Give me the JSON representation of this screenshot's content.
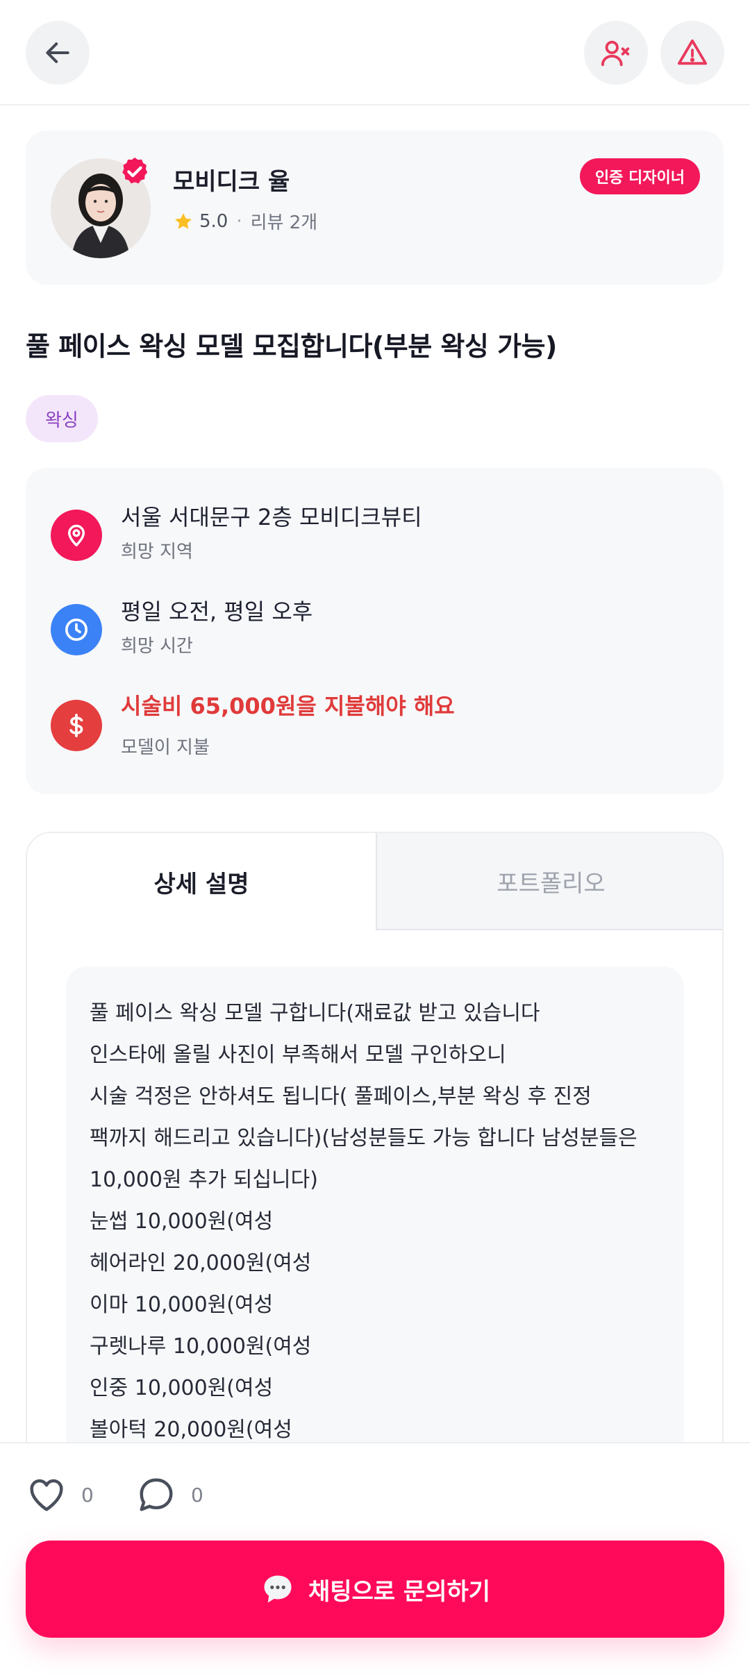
{
  "header": {
    "back_icon": "arrow-left-icon",
    "block_icon": "user-block-icon",
    "report_icon": "warning-triangle-icon"
  },
  "profile": {
    "name": "모비디크 율",
    "rating": "5.0",
    "separator": "·",
    "review_text": "리뷰 2개",
    "badge": "인증 디자이너",
    "verified_icon": "verified-check-icon"
  },
  "post": {
    "title": "풀 페이스 왁싱 모델 모집합니다(부분 왁싱 가능)",
    "category": "왁싱"
  },
  "info": {
    "location": {
      "main": "서울 서대문구 2층 모비디크뷰티",
      "sub": "희망 지역",
      "icon": "location-pin-icon",
      "color": "#f2185a"
    },
    "time": {
      "main": "평일 오전, 평일 오후",
      "sub": "희망 시간",
      "icon": "clock-icon",
      "color": "#3b82f6"
    },
    "price": {
      "main": "시술비 65,000원을 지불해야 해요",
      "sub": "모델이 지불",
      "icon": "dollar-icon",
      "color": "#e53e3e"
    }
  },
  "tabs": {
    "description": "상세 설명",
    "portfolio": "포트폴리오"
  },
  "description_lines": [
    "풀 페이스 왁싱 모델 구합니다(재료값 받고 있습니다",
    "인스타에 올릴 사진이 부족해서 모델 구인하오니",
    "시술 걱정은 안하셔도 됩니다( 풀페이스,부분 왁싱 후 진정",
    "팩까지 해드리고 있습니다)(남성분들도 가능 합니다 남성분들은",
    "10,000원 추가 되십니다)",
    "눈썹 10,000원(여성",
    "헤어라인 20,000원(여성",
    "이마 10,000원(여성",
    "구렛나루 10,000원(여성",
    "인중 10,000원(여성",
    "볼아턱 20,000원(여성"
  ],
  "stats": {
    "likes": "0",
    "comments": "0"
  },
  "cta": {
    "label": "채팅으로 문의하기"
  }
}
